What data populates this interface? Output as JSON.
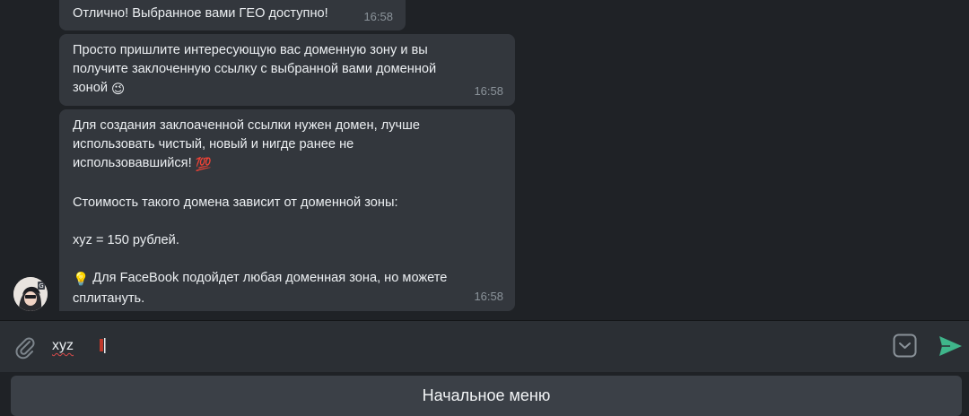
{
  "messages": [
    {
      "text": "Отлично! Выбранное вами ГЕО доступно!",
      "time": "16:58"
    },
    {
      "text": "Просто пришлите интересующую вас доменную зону и вы\nполучите заклоченную ссылку с выбранной вами доменной\nзоной",
      "emoji": "😉",
      "time": "16:58"
    },
    {
      "line1": "Для создания заклоаченной ссылки нужен домен, лучше",
      "line2": "использовать чистый, новый и нигде ранее не",
      "line3": "использовавшийся!",
      "emoji_100": "💯",
      "line4": "Стоимость такого домена зависит от доменной зоны:",
      "line5": "xyz = 150 рублей.",
      "emoji_bulb": "💡",
      "line6": "Для FaceBook подойдет любая доменная зона, но можете",
      "line7": "сплитануть.",
      "time": "16:58"
    }
  ],
  "composer": {
    "text": "xyz",
    "attach_icon": "paperclip-icon",
    "keyboard_icon": "bot-keyboard-icon",
    "send_icon": "send-icon",
    "send_color": "#3fb68b"
  },
  "reply_keyboard": {
    "button_label": "Начальное меню"
  },
  "colors": {
    "bg": "#1f2226",
    "bubble": "#33373d",
    "input_bar": "#2b2f34"
  }
}
